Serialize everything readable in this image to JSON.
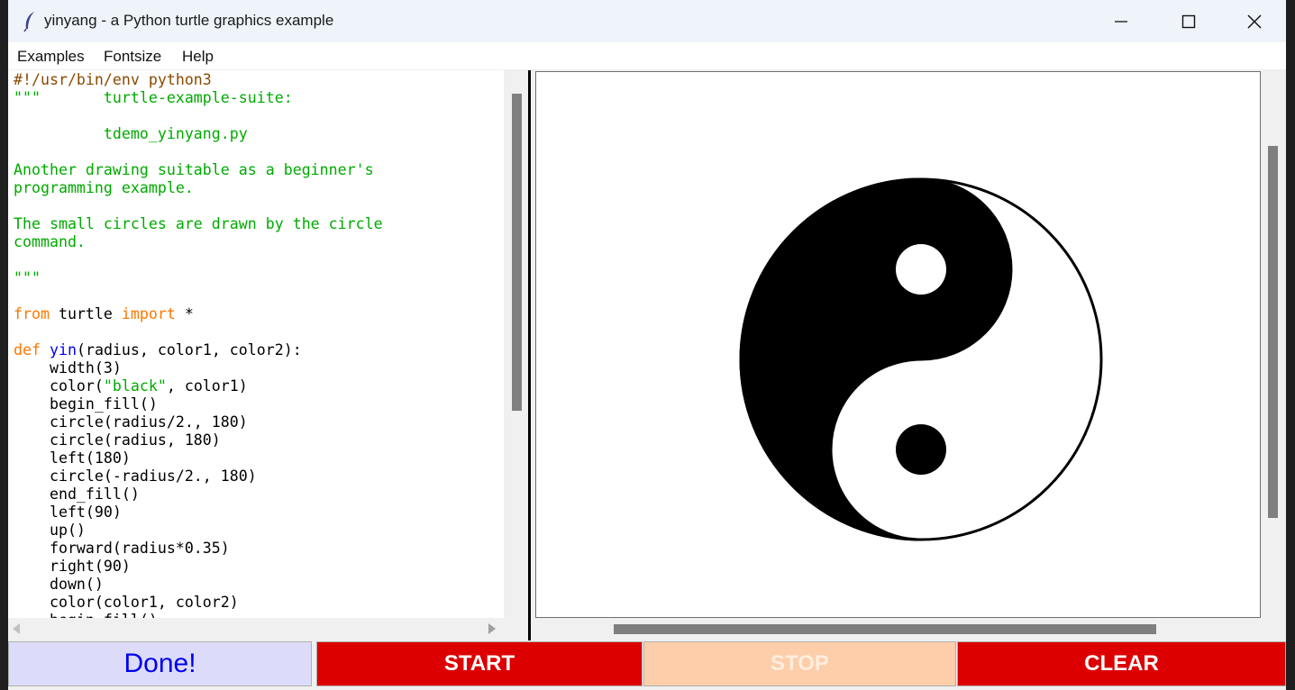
{
  "window": {
    "title": "yinyang - a Python turtle graphics example"
  },
  "menubar": {
    "items": [
      "Examples",
      "Fontsize",
      "Help"
    ]
  },
  "editor": {
    "lines": [
      [
        {
          "t": "#!/usr/bin/env python3",
          "c": "shebang"
        }
      ],
      [
        {
          "t": "\"\"\"       turtle-example-suite:",
          "c": "doc"
        }
      ],
      [],
      [
        {
          "t": "          tdemo_yinyang.py",
          "c": "doc"
        }
      ],
      [],
      [
        {
          "t": "Another drawing suitable as a beginner's",
          "c": "doc"
        }
      ],
      [
        {
          "t": "programming example.",
          "c": "doc"
        }
      ],
      [],
      [
        {
          "t": "The small circles are drawn by the circle",
          "c": "doc"
        }
      ],
      [
        {
          "t": "command.",
          "c": "doc"
        }
      ],
      [],
      [
        {
          "t": "\"\"\"",
          "c": "doc"
        }
      ],
      [],
      [
        {
          "t": "from",
          "c": "kw"
        },
        {
          "t": " turtle "
        },
        {
          "t": "import",
          "c": "kw"
        },
        {
          "t": " *"
        }
      ],
      [],
      [
        {
          "t": "def",
          "c": "kw"
        },
        {
          "t": " "
        },
        {
          "t": "yin",
          "c": "def"
        },
        {
          "t": "(radius, color1, color2):"
        }
      ],
      [
        {
          "t": "    width(3)"
        }
      ],
      [
        {
          "t": "    color("
        },
        {
          "t": "\"black\"",
          "c": "str"
        },
        {
          "t": ", color1)"
        }
      ],
      [
        {
          "t": "    begin_fill()"
        }
      ],
      [
        {
          "t": "    circle(radius/2., 180)"
        }
      ],
      [
        {
          "t": "    circle(radius, 180)"
        }
      ],
      [
        {
          "t": "    left(180)"
        }
      ],
      [
        {
          "t": "    circle(-radius/2., 180)"
        }
      ],
      [
        {
          "t": "    end_fill()"
        }
      ],
      [
        {
          "t": "    left(90)"
        }
      ],
      [
        {
          "t": "    up()"
        }
      ],
      [
        {
          "t": "    forward(radius*0.35)"
        }
      ],
      [
        {
          "t": "    right(90)"
        }
      ],
      [
        {
          "t": "    down()"
        }
      ],
      [
        {
          "t": "    color(color1, color2)"
        }
      ],
      [
        {
          "t": "    begin_fill()"
        }
      ]
    ]
  },
  "buttons": {
    "done": "Done!",
    "start": "START",
    "stop": "STOP",
    "clear": "CLEAR"
  },
  "colors": {
    "titlebar_bg": "#eef4f9",
    "keyword": "#ff7700",
    "function_name": "#0000ff",
    "docstring": "#00aa00",
    "shebang": "#8a4a00",
    "done_bg": "#dcdcfa",
    "start_bg": "#dd0000",
    "stop_bg": "#fecdaa",
    "clear_bg": "#dd0000"
  },
  "icons": [
    "feather-icon",
    "minimize-icon",
    "maximize-icon",
    "close-icon"
  ]
}
